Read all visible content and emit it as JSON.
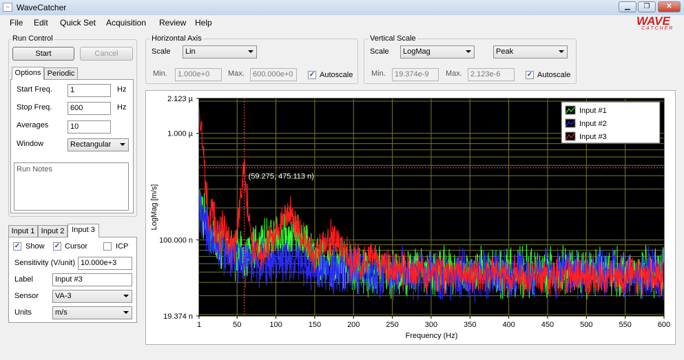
{
  "window": {
    "title": "WaveCatcher",
    "app_icon": "waveform-icon",
    "minimize": "▁",
    "restore": "❐",
    "close": "✕"
  },
  "menu": [
    "File",
    "Edit",
    "Quick Set",
    "Acquisition",
    "Review",
    "Help"
  ],
  "logo": {
    "text": "WAVE",
    "sub": "CATCHER",
    "color": "#d02020"
  },
  "run_control": {
    "label": "Run Control",
    "start": "Start",
    "cancel": "Cancel",
    "tabs": [
      "Options",
      "Periodic"
    ],
    "start_freq": {
      "label": "Start Freq.",
      "value": "1",
      "unit": "Hz"
    },
    "stop_freq": {
      "label": "Stop Freq.",
      "value": "600",
      "unit": "Hz"
    },
    "averages": {
      "label": "Averages",
      "value": "10"
    },
    "window": {
      "label": "Window",
      "value": "Rectangular"
    },
    "notes_placeholder": "Run Notes"
  },
  "inputs": {
    "tabs": [
      "Input 1",
      "Input 2",
      "Input 3"
    ],
    "show": {
      "label": "Show",
      "checked": true
    },
    "cursor": {
      "label": "Cursor",
      "checked": true
    },
    "icp": {
      "label": "ICP",
      "checked": false
    },
    "sensitivity": {
      "label": "Sensitivity (V/unit)",
      "value": "10.000e+3"
    },
    "label_field": {
      "label": "Label",
      "value": "Input #3"
    },
    "sensor": {
      "label": "Sensor",
      "value": "VA-3"
    },
    "units": {
      "label": "Units",
      "value": "m/s"
    }
  },
  "horizontal": {
    "label": "Horizontal Axis",
    "scale_label": "Scale",
    "scale": "Lin",
    "min_label": "Min.",
    "min": "1.000e+0",
    "max_label": "Max.",
    "max": "600.000e+0",
    "autoscale": {
      "label": "Autoscale",
      "checked": true
    }
  },
  "vertical": {
    "label": "Vertical Scale",
    "scale_label": "Scale",
    "scale": "LogMag",
    "mode": "Peak",
    "min_label": "Min.",
    "min": "19.374e-9",
    "max_label": "Max.",
    "max": "2.123e-6",
    "autoscale": {
      "label": "Autoscale",
      "checked": true
    }
  },
  "chart_data": {
    "type": "line",
    "xlabel": "Frequency (Hz)",
    "ylabel": "LogMag [m/s]",
    "xlim": [
      1,
      600
    ],
    "ylim": [
      1.9374e-08,
      2.123e-06
    ],
    "yscale": "log",
    "x_ticks": [
      1,
      50,
      100,
      150,
      200,
      250,
      300,
      350,
      400,
      450,
      500,
      550,
      600
    ],
    "y_ticks": [
      {
        "value": 2.123e-06,
        "label": "2.123 µ"
      },
      {
        "value": 1e-06,
        "label": "1.000 µ"
      },
      {
        "value": 1e-07,
        "label": "100.000 n"
      },
      {
        "value": 1.9374e-08,
        "label": "19.374 n"
      }
    ],
    "grid": true,
    "legend_position": "top-right",
    "background": "#000000",
    "grid_color": "#7a7a2c",
    "cursor": {
      "x": 59.275,
      "y": 4.75113e-07,
      "label": "(59.275, 475.113 n)",
      "color": "#ff5050"
    },
    "series": [
      {
        "name": "Input #1",
        "color": "#33ff33",
        "noise": 0.18,
        "points": [
          [
            1,
            2.2e-07
          ],
          [
            5,
            1.8e-07
          ],
          [
            10,
            1.5e-07
          ],
          [
            15,
            1.2e-07
          ],
          [
            20,
            1.05e-07
          ],
          [
            30,
            9e-08
          ],
          [
            40,
            8e-08
          ],
          [
            50,
            7e-08
          ],
          [
            60,
            7.3e-08
          ],
          [
            70,
            8e-08
          ],
          [
            80,
            8.5e-08
          ],
          [
            90,
            1e-07
          ],
          [
            100,
            1.05e-07
          ],
          [
            110,
            1.05e-07
          ],
          [
            120,
            1e-07
          ],
          [
            130,
            1e-07
          ],
          [
            140,
            9e-08
          ],
          [
            150,
            7e-08
          ],
          [
            160,
            6e-08
          ],
          [
            180,
            5.5e-08
          ],
          [
            200,
            5.5e-08
          ],
          [
            250,
            5e-08
          ],
          [
            300,
            5e-08
          ],
          [
            350,
            5e-08
          ],
          [
            400,
            5e-08
          ],
          [
            450,
            5e-08
          ],
          [
            500,
            5e-08
          ],
          [
            550,
            5e-08
          ],
          [
            600,
            5e-08
          ]
        ]
      },
      {
        "name": "Input #2",
        "color": "#2a2aff",
        "noise": 0.18,
        "points": [
          [
            1,
            2e-07
          ],
          [
            5,
            1.6e-07
          ],
          [
            10,
            1.3e-07
          ],
          [
            15,
            1.1e-07
          ],
          [
            20,
            9.5e-08
          ],
          [
            30,
            8.5e-08
          ],
          [
            40,
            7.5e-08
          ],
          [
            50,
            6.5e-08
          ],
          [
            60,
            6.5e-08
          ],
          [
            70,
            6.2e-08
          ],
          [
            80,
            6e-08
          ],
          [
            90,
            6e-08
          ],
          [
            100,
            6.5e-08
          ],
          [
            120,
            6.5e-08
          ],
          [
            150,
            5.5e-08
          ],
          [
            180,
            5.2e-08
          ],
          [
            200,
            5.2e-08
          ],
          [
            250,
            4.8e-08
          ],
          [
            300,
            4.8e-08
          ],
          [
            350,
            4.8e-08
          ],
          [
            400,
            4.8e-08
          ],
          [
            450,
            4.8e-08
          ],
          [
            500,
            4.8e-08
          ],
          [
            550,
            4.8e-08
          ],
          [
            600,
            4.8e-08
          ]
        ]
      },
      {
        "name": "Input #3",
        "color": "#ff2020",
        "noise": 0.14,
        "points": [
          [
            1,
            2e-06
          ],
          [
            3,
            1.2e-06
          ],
          [
            6,
            7e-07
          ],
          [
            9,
            3.5e-07
          ],
          [
            12,
            2e-07
          ],
          [
            15,
            1.5e-07
          ],
          [
            18,
            2.1e-07
          ],
          [
            22,
            1.3e-07
          ],
          [
            27,
            1.05e-07
          ],
          [
            32,
            1.35e-07
          ],
          [
            37,
            1e-07
          ],
          [
            42,
            8e-08
          ],
          [
            48,
            1e-07
          ],
          [
            53,
            2e-07
          ],
          [
            59.275,
            4.75e-07
          ],
          [
            64,
            2e-07
          ],
          [
            70,
            8e-08
          ],
          [
            80,
            7e-08
          ],
          [
            90,
            9e-08
          ],
          [
            100,
            1.2e-07
          ],
          [
            110,
            1.55e-07
          ],
          [
            120,
            1.8e-07
          ],
          [
            130,
            1.3e-07
          ],
          [
            140,
            9e-08
          ],
          [
            150,
            7e-08
          ],
          [
            160,
            8.5e-08
          ],
          [
            170,
            1.05e-07
          ],
          [
            180,
            1e-07
          ],
          [
            190,
            7.5e-08
          ],
          [
            200,
            6e-08
          ],
          [
            210,
            6e-08
          ],
          [
            225,
            7e-08
          ],
          [
            240,
            6e-08
          ],
          [
            260,
            5e-08
          ],
          [
            300,
            4.8e-08
          ],
          [
            350,
            4.7e-08
          ],
          [
            400,
            4.7e-08
          ],
          [
            450,
            4.6e-08
          ],
          [
            500,
            4.6e-08
          ],
          [
            550,
            4.5e-08
          ],
          [
            600,
            4.5e-08
          ]
        ]
      }
    ]
  }
}
